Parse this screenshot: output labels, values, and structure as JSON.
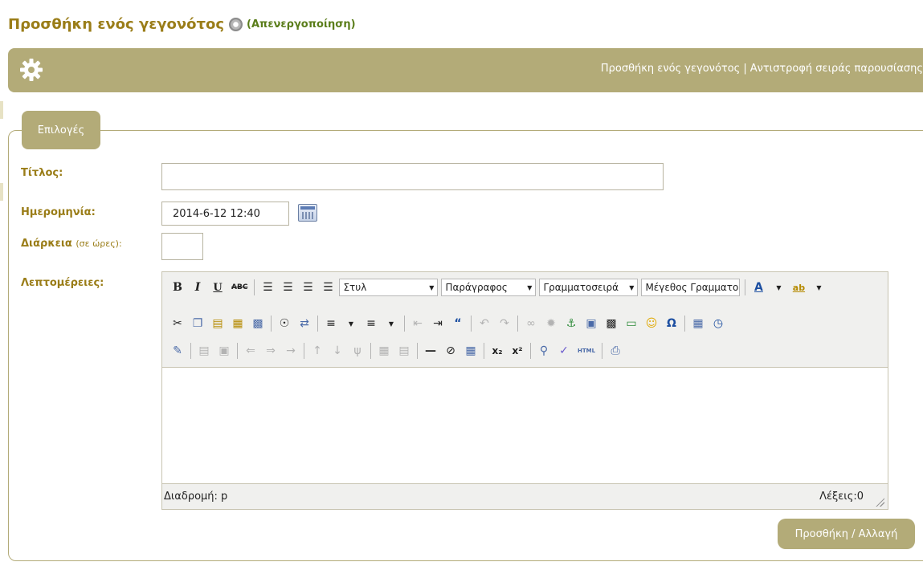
{
  "header": {
    "title": "Προσθήκη ενός γεγονότος",
    "toggle_label": "(Απενεργοποίηση)",
    "icon": "help-circle-icon"
  },
  "topbar": {
    "gear_icon": "gear-icon",
    "links": [
      "Προσθήκη ενός γεγονότος",
      "Αντιστροφή σειράς παρουσίασης"
    ],
    "separator": "|"
  },
  "form": {
    "legend": "Επιλογές",
    "title_label": "Τίτλος:",
    "title_value": "",
    "date_label": "Ημερομηνία:",
    "date_value": "2014-6-12 12:40",
    "duration_label": "Διάρκεια",
    "duration_hint": "(σε ώρες):",
    "duration_value": "",
    "details_label": "Λεπτομέρειες:",
    "submit_label": "Προσθήκη / Αλλαγή"
  },
  "editor": {
    "style_select": "Στυλ",
    "format_select": "Παράγραφος",
    "font_select": "Γραμματοσειρά",
    "size_select": "Μέγεθος Γραμματοσειράς",
    "status_path": "Διαδρομή: p",
    "word_count": "Λέξεις:0",
    "bold": "B",
    "italic": "I",
    "underline": "U",
    "strike": "ABC",
    "html": "HTML"
  },
  "colors": {
    "accent": "#b3ab78",
    "title": "#9a7d18",
    "toggle": "#5a7d1a"
  }
}
